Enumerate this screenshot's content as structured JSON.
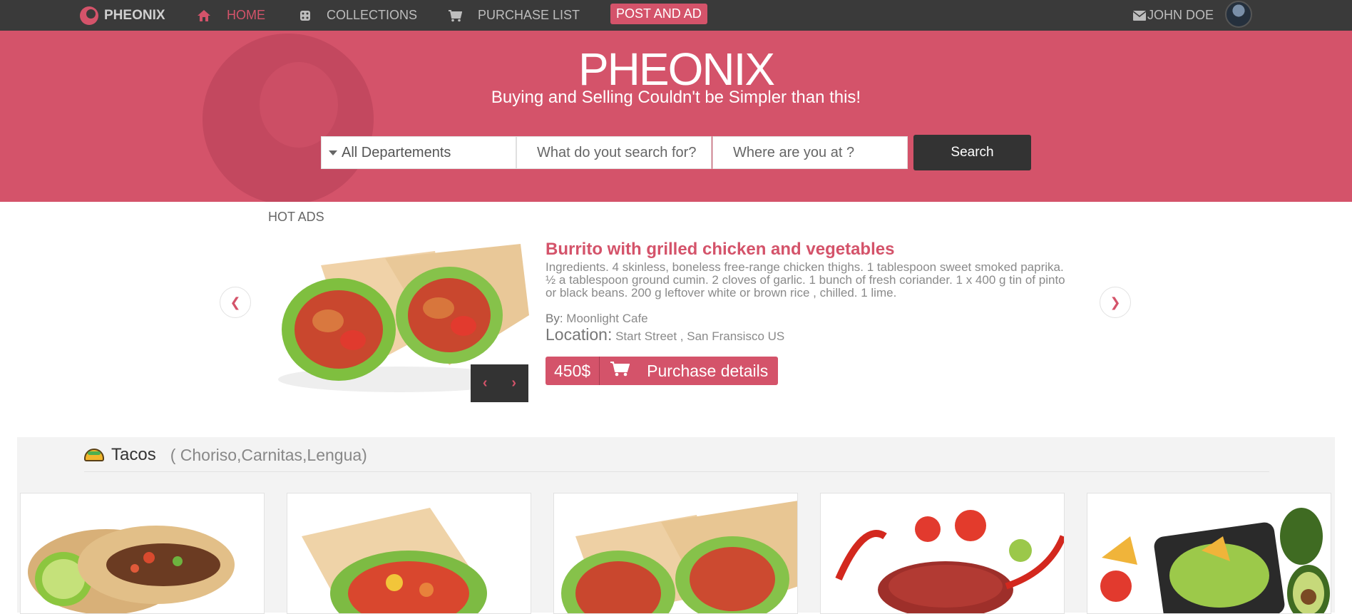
{
  "nav": {
    "brand": "PHEONIX",
    "home": "HOME",
    "collections": "COLLECTIONS",
    "purchase_list": "PURCHASE LIST",
    "post_ad": "POST AND AD",
    "user": "JOHN DOE"
  },
  "hero": {
    "title": "PHEONIX",
    "subtitle": "Buying and Selling Couldn't be Simpler than this!",
    "department": "All Departements",
    "what_placeholder": "What do yout search for?",
    "where_placeholder": "Where are you at ?",
    "search_label": "Search"
  },
  "hot_ads": {
    "label": "HOT ADS",
    "title": "Burrito with grilled chicken and vegetables",
    "description": "Ingredients. 4 skinless, boneless free-range chicken thighs. 1 tablespoon sweet smoked paprika. ½ a tablespoon ground cumin. 2 cloves of garlic. 1 bunch of fresh coriander. 1 x 400 g tin of pinto or black beans. 200 g leftover white or brown rice , chilled. 1 lime.",
    "by_label": "By:",
    "by_value": "Moonlight Cafe",
    "location_label": "Location:",
    "location_value": "Start Street , San Fransisco US",
    "price": "450$",
    "purchase_label": "Purchase details"
  },
  "category": {
    "name": "Tacos",
    "subtitle": "( Choriso,Carnitas,Lengua)"
  },
  "icons": {
    "brand": "phoenix-logo-icon",
    "home": "home-icon",
    "collections": "dice-icon",
    "purchase": "cart-icon",
    "user": "envelope-icon",
    "caret": "caret-down-icon"
  },
  "colors": {
    "accent": "#d4536a",
    "navbar": "#3a3a3a",
    "dark_button": "#333333"
  }
}
